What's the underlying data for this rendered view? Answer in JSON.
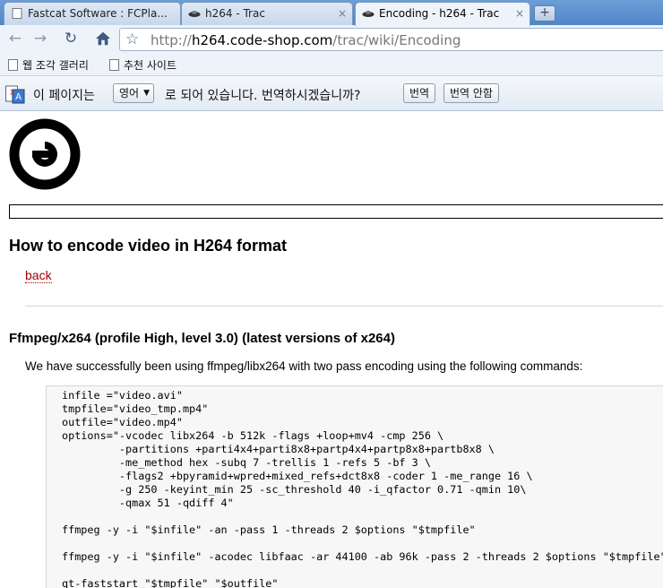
{
  "browser": {
    "tabs": [
      {
        "title": "Fastcat Software : FCPla..."
      },
      {
        "title": "h264 - Trac"
      },
      {
        "title": "Encoding - h264 - Trac"
      }
    ],
    "new_tab": "+",
    "close_glyph": "×",
    "url_scheme": "http://",
    "url_host": "h264.code-shop.com",
    "url_path": "/trac/wiki/Encoding",
    "bookmarks": [
      {
        "label": "웹 조각 갤러리"
      },
      {
        "label": "추천 사이트"
      }
    ],
    "icons": {
      "back": "arrow-left-icon",
      "forward": "arrow-right-icon",
      "reload": "reload-icon",
      "home": "home-icon",
      "bookmark": "star-icon"
    }
  },
  "translate_bar": {
    "prefix": "이 페이지는",
    "language": "영어",
    "suffix": "로 되어 있습니다. 번역하시겠습니까?",
    "translate_button": "번역",
    "no_translate_button": "번역 안함"
  },
  "page": {
    "title": "How to encode video in H264 format",
    "back_link": "back",
    "section_title": "Ffmpeg/x264 (profile High, level 3.0) (latest versions of x264)",
    "intro": "We have successfully been using ffmpeg/libx264 with two pass encoding using the following commands:",
    "code_lines": [
      "infile =\"video.avi\"",
      "tmpfile=\"video_tmp.mp4\"",
      "outfile=\"video.mp4\"",
      "options=\"-vcodec libx264 -b 512k -flags +loop+mv4 -cmp 256 \\",
      "         -partitions +parti4x4+parti8x8+partp4x4+partp8x8+partb8x8 \\",
      "         -me_method hex -subq 7 -trellis 1 -refs 5 -bf 3 \\",
      "         -flags2 +bpyramid+wpred+mixed_refs+dct8x8 -coder 1 -me_range 16 \\",
      "         -g 250 -keyint_min 25 -sc_threshold 40 -i_qfactor 0.71 -qmin 10\\",
      "         -qmax 51 -qdiff 4\"",
      "",
      "ffmpeg -y -i \"$infile\" -an -pass 1 -threads 2 $options \"$tmpfile\"",
      "",
      "ffmpeg -y -i \"$infile\" -acodec libfaac -ar 44100 -ab 96k -pass 2 -threads 2 $options \"$tmpfile\"",
      "",
      "qt-faststart \"$tmpfile\" \"$outfile\""
    ]
  },
  "colors": {
    "link": "#a10000",
    "tabstrip": "#5b8fcc",
    "code_bg": "#f7f7f7"
  }
}
